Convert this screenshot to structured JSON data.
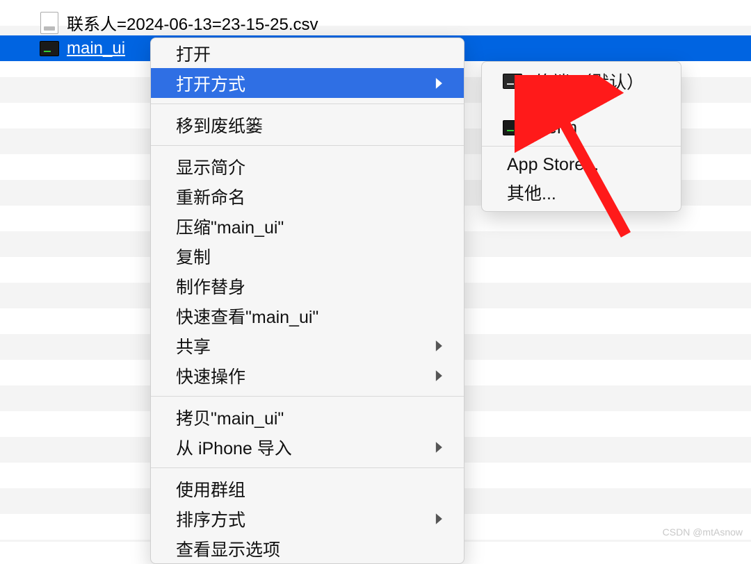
{
  "files": {
    "csv_name": "联系人=2024-06-13=23-15-25.csv",
    "selected_name": "main_ui"
  },
  "context_menu": {
    "open": "打开",
    "open_with": "打开方式",
    "trash": "移到废纸篓",
    "get_info": "显示简介",
    "rename": "重新命名",
    "compress": "压缩\"main_ui\"",
    "copy": "复制",
    "make_alias": "制作替身",
    "quick_look": "快速查看\"main_ui\"",
    "share": "共享",
    "quick_actions": "快速操作",
    "copy_item": "拷贝\"main_ui\"",
    "import_iphone": "从 iPhone 导入",
    "use_groups": "使用群组",
    "sort_by": "排序方式",
    "view_options": "查看显示选项"
  },
  "submenu": {
    "terminal_default": "终端 （默认）",
    "iterm": "iTerm",
    "app_store": "App Store...",
    "other": "其他..."
  },
  "watermark": "CSDN @mtAsnow"
}
